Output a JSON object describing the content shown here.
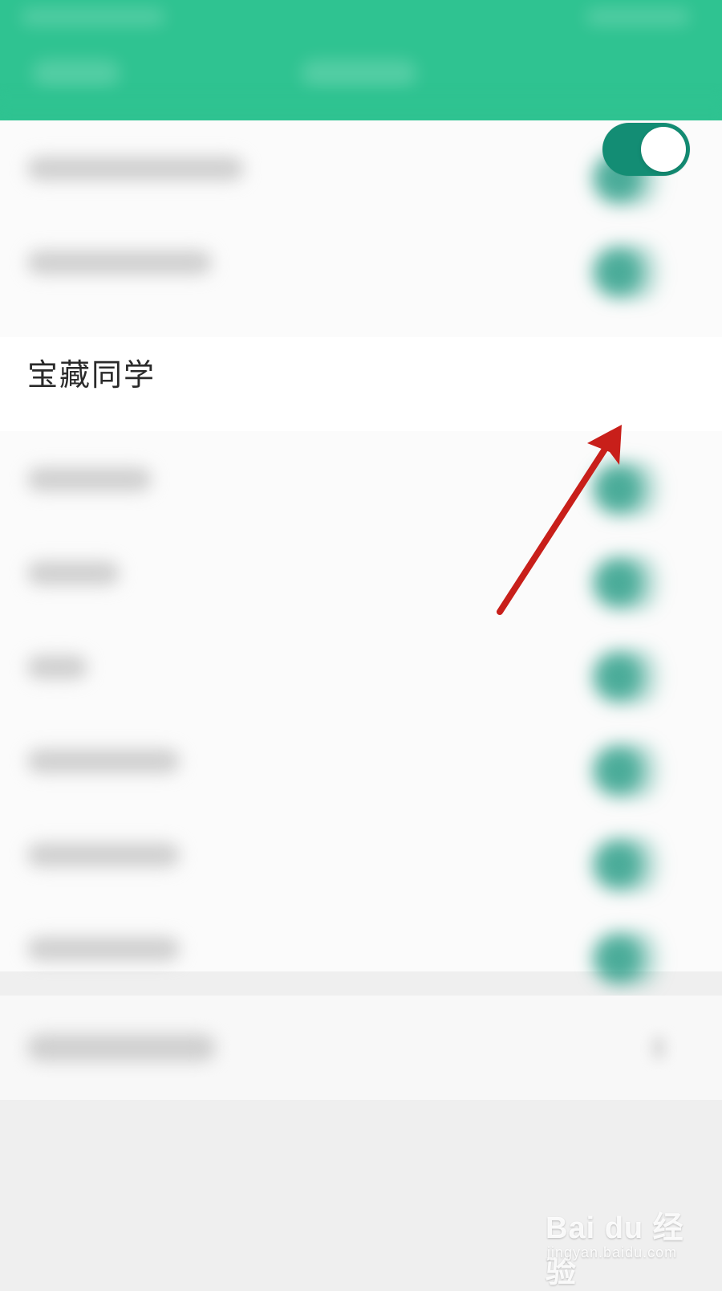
{
  "header": {
    "background": "#2fc391"
  },
  "list": {
    "featured_item": {
      "label": "宝藏同学",
      "toggle_on": true
    }
  },
  "watermark": {
    "brand": "Bai du 经验",
    "url": "jingyan.baidu.com"
  },
  "colors": {
    "toggle_on": "#138d74",
    "arrow": "#c81f1a"
  }
}
